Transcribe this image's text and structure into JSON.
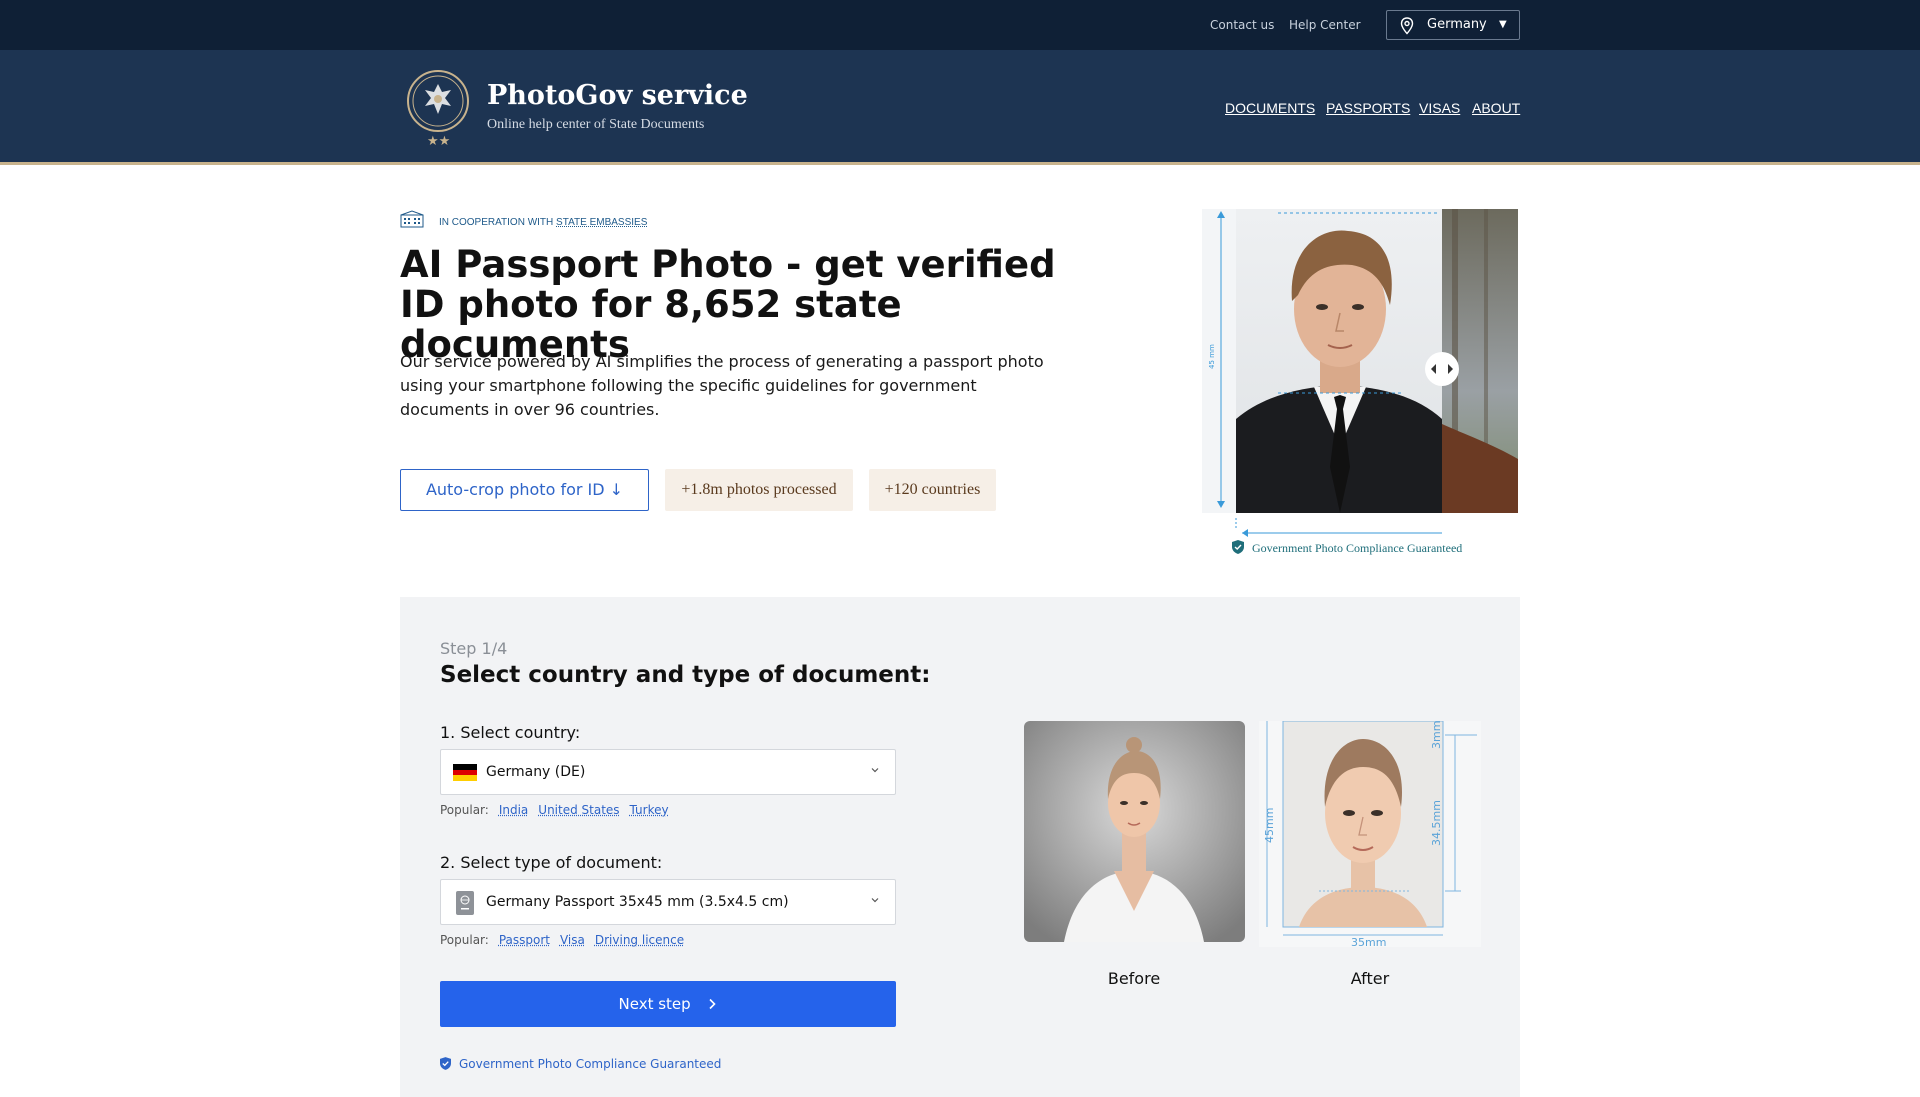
{
  "topbar": {
    "contact": "Contact us",
    "help": "Help Center",
    "country": "Germany"
  },
  "header": {
    "brand": "PhotoGov service",
    "subtitle": "Online help center of State Documents",
    "nav": [
      "DOCUMENTS",
      "PASSPORTS",
      "VISAS",
      "ABOUT"
    ]
  },
  "hero": {
    "coop_prefix": "IN COOPERATION WITH ",
    "coop_link": "STATE EMBASSIES",
    "title_bold": "AI Passport Photo",
    "title_rest": " - get verified ID photo for 8,652 state documents",
    "lead": "Our service powered by AI simplifies the process of generating a passport photo using your smartphone following the specific guidelines for government documents in over 96 countries.",
    "autocrop": "Auto-crop photo for ID ↓",
    "photos_processed": "+1.8m photos processed",
    "countries": "+120 countries",
    "image_dimension_label": "45 mm",
    "compliance": "Government Photo Compliance Guaranteed"
  },
  "steps": {
    "step_label": "Step 1/4",
    "title": "Select country and type of document:",
    "country_label": "1. Select country:",
    "country_value": "Germany (DE)",
    "popular_label": "Popular:",
    "popular_countries": [
      "India",
      "United States",
      "Turkey"
    ],
    "doc_label": "2. Select type of document:",
    "doc_value": "Germany Passport 35x45 mm (3.5x4.5 cm)",
    "popular_docs": [
      "Passport",
      "Visa",
      "Driving licence"
    ],
    "next": "Next step",
    "compliance": "Government Photo Compliance Guaranteed",
    "before": "Before",
    "after": "After",
    "dim_height": "45mm",
    "dim_width": "35mm",
    "dim_top": "3mm",
    "dim_head": "34.5mm"
  },
  "colors": {
    "topbar": "#0f2036",
    "header": "#1d3452",
    "accent": "#2563eb",
    "gold": "#c8b38d"
  }
}
